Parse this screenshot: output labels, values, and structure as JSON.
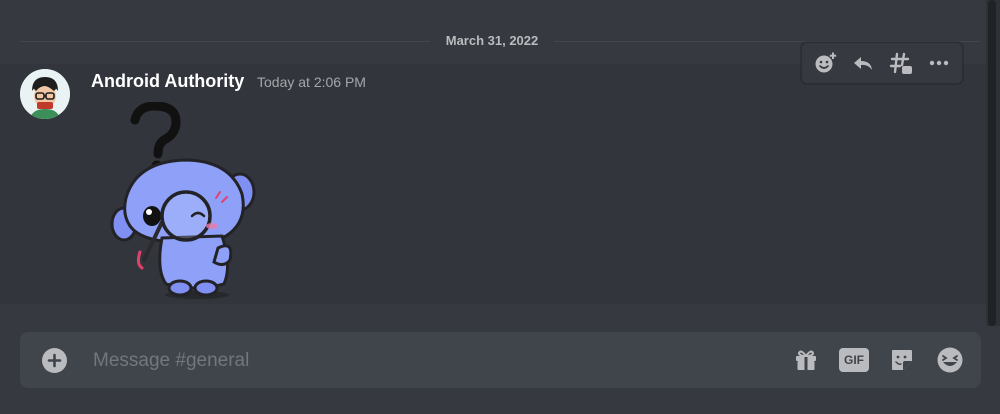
{
  "chat": {
    "date_divider": "March 31, 2022",
    "message": {
      "author": "Android Authority",
      "timestamp": "Today at 2:06 PM"
    }
  },
  "message_toolbar": {
    "icons": [
      "add-reaction-icon",
      "reply-icon",
      "create-thread-icon",
      "more-options-icon"
    ]
  },
  "composer": {
    "placeholder": "Message #general",
    "gif_label": "GIF",
    "icons": [
      "add-attachment-icon",
      "gift-icon",
      "gif-icon",
      "sticker-icon",
      "emoji-icon"
    ]
  },
  "colors": {
    "background": "#36393f",
    "message_hover": "#32353b",
    "input_background": "#40444b",
    "icon": "#b9bbbe",
    "sticker_blue": "#7289da"
  }
}
